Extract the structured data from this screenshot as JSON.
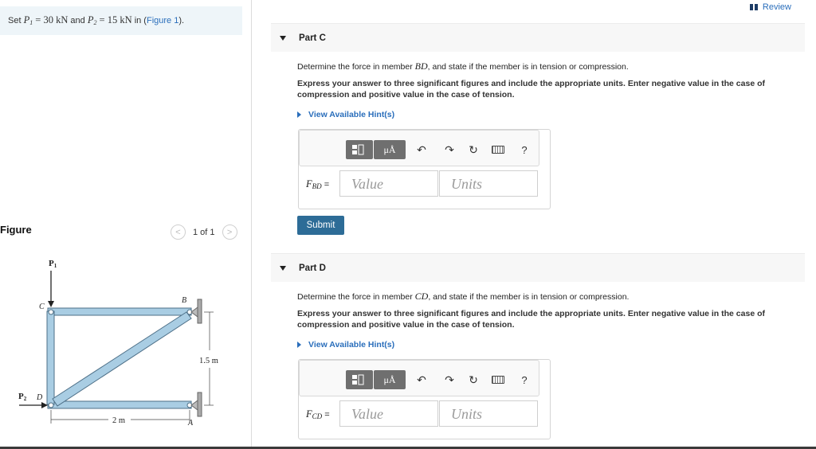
{
  "problem": {
    "prefix": "Set",
    "p1_sym": "P",
    "p1_sub": "1",
    "p1_val": "= 30 kN",
    "and": "and",
    "p2_sym": "P",
    "p2_sub": "2",
    "p2_val": "= 15 kN",
    "in": "in (",
    "figure_link": "Figure 1",
    "close": ")."
  },
  "figure_panel": {
    "label": "Figure",
    "prev": "<",
    "next": ">",
    "page": "1 of 1"
  },
  "diagram": {
    "label_p1": "P",
    "label_p1_sub": "1",
    "label_p2": "P",
    "label_p2_sub": "2",
    "label_c": "C",
    "label_b": "B",
    "label_d": "D",
    "label_a": "A",
    "dim_height": "1.5 m",
    "dim_width": "2 m"
  },
  "review": {
    "label": "Review"
  },
  "parts": [
    {
      "title": "Part C",
      "q_pre": "Determine the force in member",
      "member": "BD",
      "q_post": ", and state if the member is in tension or compression.",
      "instructions": "Express your answer to three significant figures and include the appropriate units. Enter negative value in the case of compression and positive value in the case of tension.",
      "hint": "View Available Hint(s)",
      "var_main": "F",
      "var_sub": "BD",
      "eq": "=",
      "value_placeholder": "Value",
      "units_placeholder": "Units",
      "submit": "Submit"
    },
    {
      "title": "Part D",
      "q_pre": "Determine the force in member",
      "member": "CD",
      "q_post": ", and state if the member is in tension or compression.",
      "instructions": "Express your answer to three significant figures and include the appropriate units. Enter negative value in the case of compression and positive value in the case of tension.",
      "hint": "View Available Hint(s)",
      "var_main": "F",
      "var_sub": "CD",
      "eq": "=",
      "value_placeholder": "Value",
      "units_placeholder": "Units"
    }
  ],
  "toolbar": {
    "mu_label": "μÅ",
    "undo_icon": "↶",
    "redo_icon": "↷",
    "reset_icon": "↻",
    "help": "?"
  },
  "colors": {
    "link": "#2a6ebb",
    "submit_bg": "#2d6c97",
    "truss_member": "#a9cde3",
    "truss_outline": "#4d6f87",
    "problem_bg": "#eef5f9"
  },
  "icons": [
    "review-book-icon",
    "triangle-down-icon",
    "triangle-right-icon",
    "template-icon",
    "undo-icon",
    "redo-icon",
    "reset-icon",
    "keyboard-icon",
    "help-icon",
    "chevron-left-icon",
    "chevron-right-icon"
  ]
}
